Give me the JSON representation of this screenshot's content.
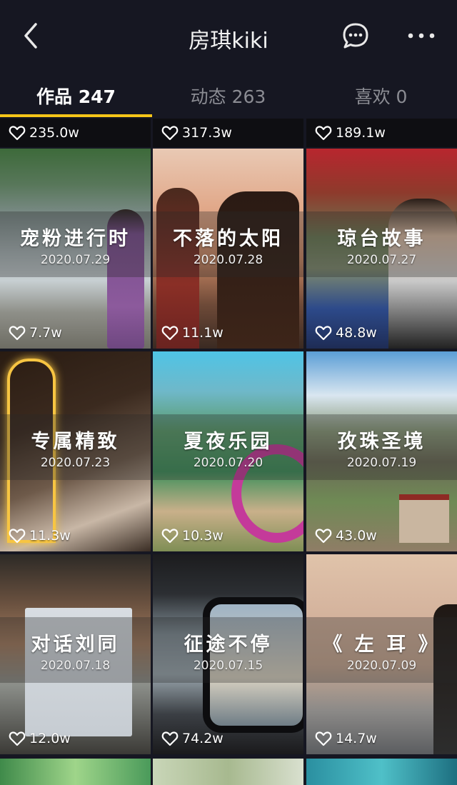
{
  "header": {
    "title": "房琪kiki",
    "back_icon": "chevron-left-icon",
    "message_icon": "chat-bubble-icon",
    "more_icon": "ellipsis-icon"
  },
  "tabs": [
    {
      "label": "作品 247",
      "active": true
    },
    {
      "label": "动态 263",
      "active": false
    },
    {
      "label": "喜欢 0",
      "active": false
    }
  ],
  "colors": {
    "background": "#161722",
    "accent": "#f5c518",
    "inactive_tab": "#8b8c93"
  },
  "top_row_likes": [
    "235.0w",
    "317.3w",
    "189.1w"
  ],
  "videos": [
    {
      "title": "宠粉进行时",
      "date": "2020.07.29",
      "likes": "7.7w"
    },
    {
      "title": "不落的太阳",
      "date": "2020.07.28",
      "likes": "11.1w"
    },
    {
      "title": "琼台故事",
      "date": "2020.07.27",
      "likes": "48.8w"
    },
    {
      "title": "专属精致",
      "date": "2020.07.23",
      "likes": "11.3w"
    },
    {
      "title": "夏夜乐园",
      "date": "2020.07.20",
      "likes": "10.3w"
    },
    {
      "title": "孜珠圣境",
      "date": "2020.07.19",
      "likes": "43.0w"
    },
    {
      "title": "对话刘同",
      "date": "2020.07.18",
      "likes": "12.0w"
    },
    {
      "title": "征途不停",
      "date": "2020.07.15",
      "likes": "74.2w"
    },
    {
      "title": "《 左  耳 》",
      "date": "2020.07.09",
      "likes": "14.7w"
    }
  ]
}
